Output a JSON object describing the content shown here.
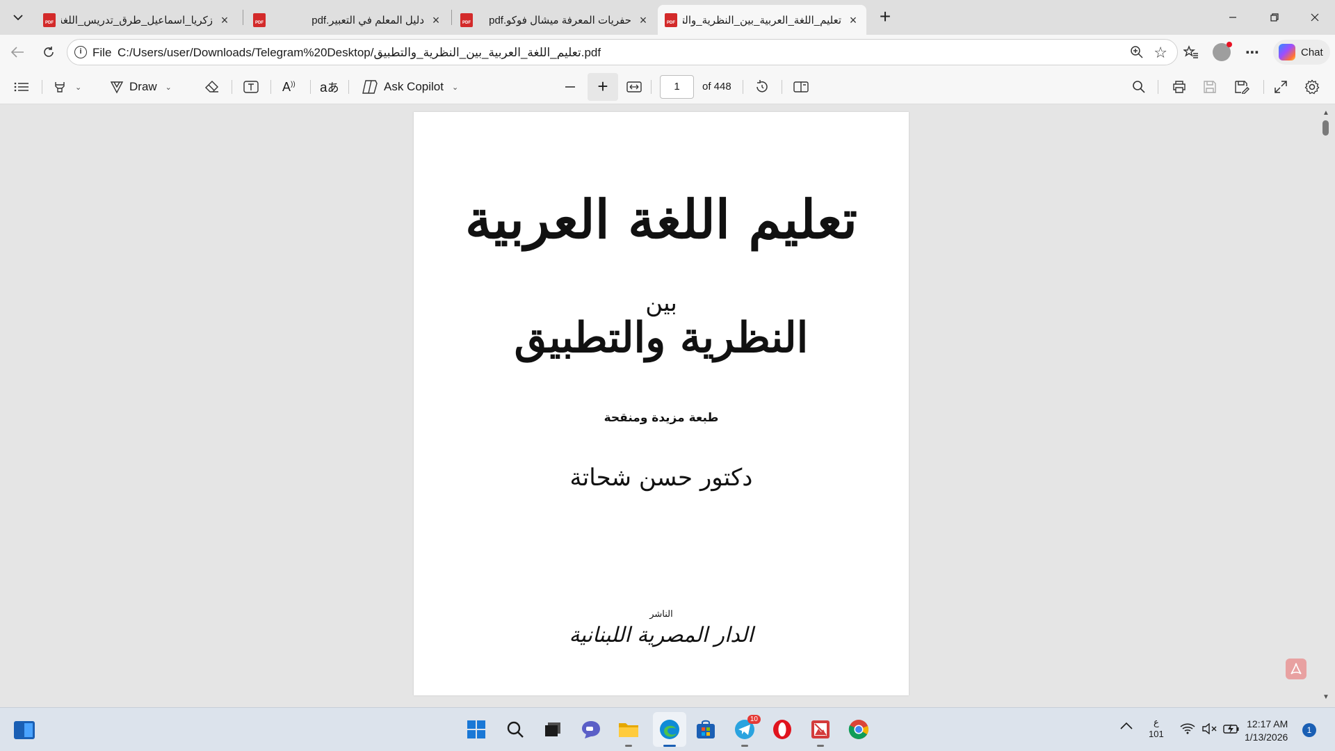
{
  "tabs": [
    {
      "title": "زكريا_اسماعيل_طرق_تدريس_اللغة_ال",
      "active": false
    },
    {
      "title": "دليل المعلم في التعبير.pdf",
      "active": false
    },
    {
      "title": "حفريات المعرفة ميشال فوكو.pdf",
      "active": false
    },
    {
      "title": "تعليم_اللغة_العربية_بين_النظرية_والتد",
      "active": true
    }
  ],
  "address": {
    "scheme": "File",
    "url": "C:/Users/user/Downloads/Telegram%20Desktop/تعليم_اللغة_العربية_بين_النظرية_والتطبيق.pdf"
  },
  "toolbar": {
    "draw_label": "Draw",
    "ask_copilot_label": "Ask Copilot",
    "page_current": "1",
    "page_total": "of 448"
  },
  "chat_label": "Chat",
  "pdf_page": {
    "title_main": "تعليم اللغة العربية",
    "title_between": "بين",
    "title_sub": "النظرية والتطبيق",
    "edition": "طبعة مزيدة ومنقحة",
    "author": "دكتور حسن شحاتة",
    "publisher_label": "الناشر",
    "publisher_name": "الدار المصرية اللبنانية"
  },
  "taskbar": {
    "telegram_badge": "10",
    "lang_top": "ع",
    "lang_bottom": "101",
    "time": "12:17 AM",
    "date": "1/13/2026",
    "notifications": "1"
  },
  "colors": {
    "pdf_icon": "#d32a2a",
    "accent": "#1a5fb4",
    "opera": "#e0141e",
    "edge": "#0f8bd6"
  }
}
